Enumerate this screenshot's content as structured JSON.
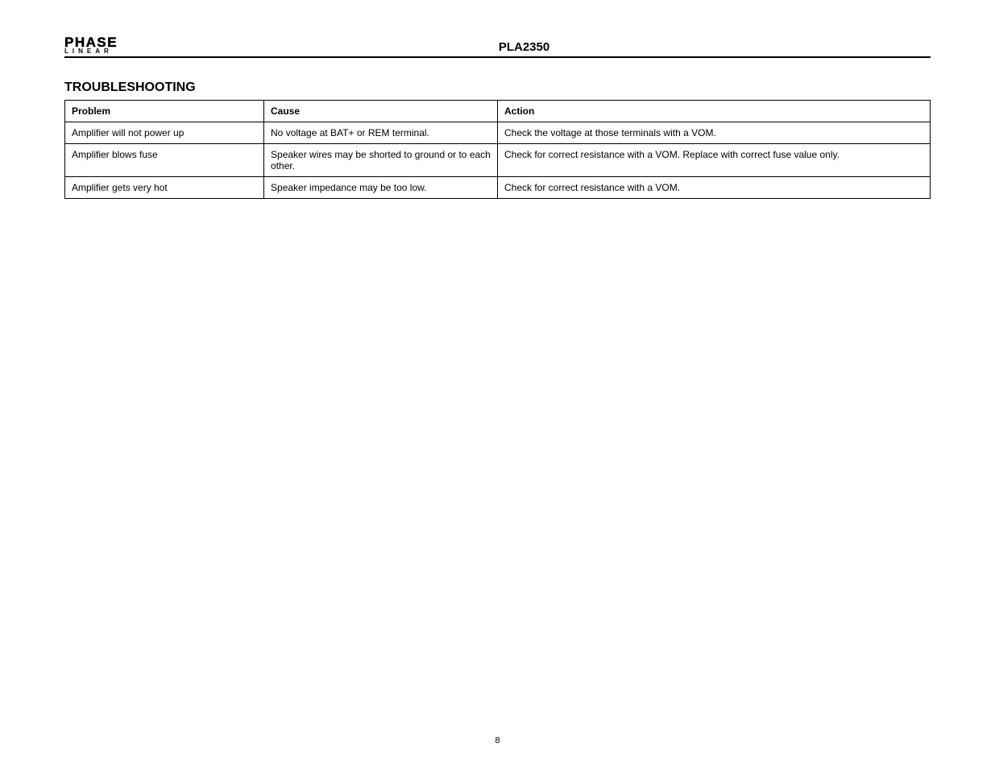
{
  "logo": {
    "main": "PHASE",
    "sub": "LINEAR"
  },
  "header_title": "PLA2350",
  "section_title": "TROUBLESHOOTING",
  "table": {
    "headers": [
      "Problem",
      "Cause",
      "Action"
    ],
    "rows": [
      {
        "problem": "Amplifier will not power up",
        "cause": "No voltage at BAT+ or REM terminal.",
        "action": "Check the voltage at those terminals with a VOM."
      },
      {
        "problem": "Amplifier blows fuse",
        "cause": "Speaker wires may be shorted to ground or to each other.",
        "action": "Check for correct resistance with a VOM. Replace with correct fuse value only."
      },
      {
        "problem": "Amplifier gets very hot",
        "cause": "Speaker impedance may be too low.",
        "action": "Check for correct resistance with a VOM."
      }
    ]
  },
  "footer": "8"
}
